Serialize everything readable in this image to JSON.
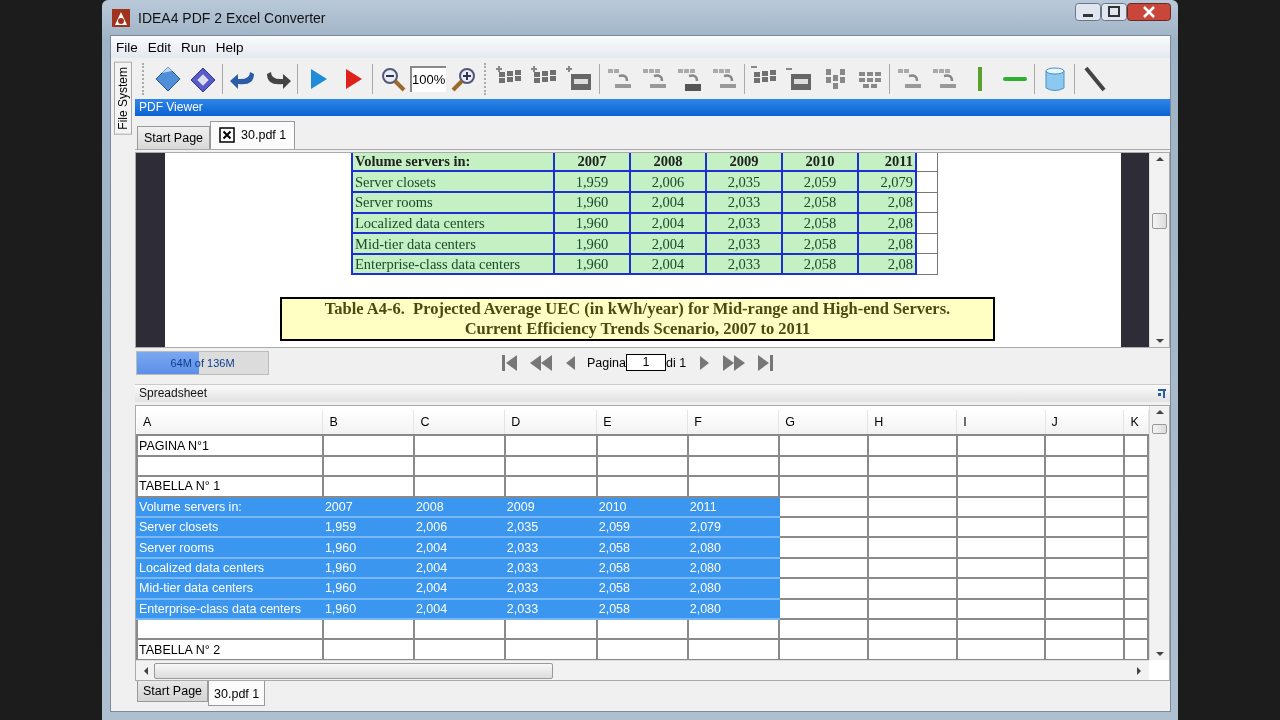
{
  "window": {
    "title": "IDEA4 PDF 2 Excel Converter"
  },
  "menu": [
    "File",
    "Edit",
    "Run",
    "Help"
  ],
  "side_tabs": [
    {
      "label": "File System"
    }
  ],
  "toolbar": {
    "zoom_value": "100%"
  },
  "pdf_viewer": {
    "title": "PDF Viewer",
    "tabs": [
      {
        "label": "Start Page",
        "selected": false,
        "closable": false
      },
      {
        "label": "30.pdf 1",
        "selected": true,
        "closable": true
      }
    ],
    "document": {
      "table": {
        "header": [
          "Volume servers in:",
          "2007",
          "2008",
          "2009",
          "2010",
          "2011"
        ],
        "rows": [
          [
            "Server closets",
            "1,959",
            "2,006",
            "2,035",
            "2,059",
            "2,079"
          ],
          [
            "Server rooms",
            "1,960",
            "2,004",
            "2,033",
            "2,058",
            "2,08"
          ],
          [
            "Localized data centers",
            "1,960",
            "2,004",
            "2,033",
            "2,058",
            "2,08"
          ],
          [
            "Mid-tier data centers",
            "1,960",
            "2,004",
            "2,033",
            "2,058",
            "2,08"
          ],
          [
            "Enterprise-class data centers",
            "1,960",
            "2,004",
            "2,033",
            "2,058",
            "2,08"
          ]
        ]
      },
      "caption": [
        "Table A4-6.  Projected Average UEC (in kWh/year) for Mid-range and High-end Servers.",
        "Current Efficiency Trends Scenario, 2007 to 2011"
      ]
    },
    "memory": {
      "text": "64M of 136M",
      "level": 0.47
    },
    "pager": {
      "label": "Pagina",
      "page": "1",
      "total": "di 1"
    }
  },
  "spreadsheet": {
    "title": "Spreadsheet",
    "columns": [
      "A",
      "B",
      "C",
      "D",
      "E",
      "F",
      "G",
      "H",
      "I",
      "J",
      "K"
    ],
    "rows": [
      {
        "cells": [
          "PAGINA N°1"
        ],
        "selected": false
      },
      {
        "cells": [],
        "selected": false
      },
      {
        "cells": [
          "TABELLA N° 1"
        ],
        "selected": false
      },
      {
        "cells": [
          "Volume servers in:",
          "2007",
          "2008",
          "2009",
          "2010",
          "2011"
        ],
        "selected": true
      },
      {
        "cells": [
          "Server closets",
          "1,959",
          "2,006",
          "2,035",
          "2,059",
          "2,079"
        ],
        "selected": true
      },
      {
        "cells": [
          "Server rooms",
          "1,960",
          "2,004",
          "2,033",
          "2,058",
          "2,080"
        ],
        "selected": true
      },
      {
        "cells": [
          "Localized data centers",
          "1,960",
          "2,004",
          "2,033",
          "2,058",
          "2,080"
        ],
        "selected": true
      },
      {
        "cells": [
          "Mid-tier data centers",
          "1,960",
          "2,004",
          "2,033",
          "2,058",
          "2,080"
        ],
        "selected": true
      },
      {
        "cells": [
          "Enterprise-class data centers",
          "1,960",
          "2,004",
          "2,033",
          "2,058",
          "2,080"
        ],
        "selected": true
      },
      {
        "cells": [],
        "selected": false
      },
      {
        "cells": [
          "TABELLA N° 2"
        ],
        "selected": false
      }
    ]
  },
  "bottom_tabs": [
    {
      "label": "Start Page",
      "selected": false
    },
    {
      "label": "30.pdf 1",
      "selected": true
    }
  ]
}
